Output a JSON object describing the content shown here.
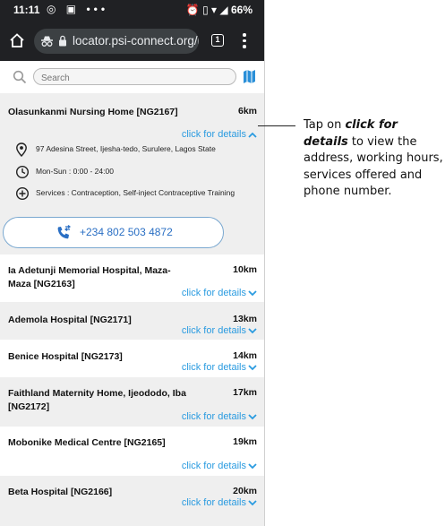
{
  "status_bar": {
    "time": "11:11",
    "battery": "66%",
    "left_icons": "◎ ▣ •••",
    "right_icons": "⏰ ▯ ▾ ◢"
  },
  "browser": {
    "url": "locator.psi-connect.org/l",
    "tab_count": "1"
  },
  "search": {
    "placeholder": "Search"
  },
  "colors": {
    "accent": "#2a9be0",
    "phone_text": "#2a6fc4",
    "toolbar": "#202124",
    "selected_row": "#efefef"
  },
  "expanded": {
    "name": "Olasunkanmi Nursing Home [NG2167]",
    "distance": "6km",
    "details_label": "click for details",
    "address": "97 Adesina Street, Ijesha-tedo, Surulere, Lagos State",
    "hours": "Mon-Sun : 0:00 - 24:00",
    "services": "Services : Contraception, Self-inject Contraceptive Training",
    "phone": "+234 802 503 4872"
  },
  "facilities": [
    {
      "name": "Ia Adetunji Memorial Hospital, Maza-Maza [NG2163]",
      "distance": "10km",
      "details_label": "click for details"
    },
    {
      "name": "Ademola Hospital [NG2171]",
      "distance": "13km",
      "details_label": "click for details"
    },
    {
      "name": "Benice Hospital [NG2173]",
      "distance": "14km",
      "details_label": "click for details"
    },
    {
      "name": "Faithland Maternity Home, Ijeododo, Iba [NG2172]",
      "distance": "17km",
      "details_label": "click for details"
    },
    {
      "name": "Mobonike Medical Centre [NG2165]",
      "distance": "19km",
      "details_label": "click for details"
    },
    {
      "name": "Beta Hospital [NG2166]",
      "distance": "20km",
      "details_label": "click for details"
    }
  ],
  "annotation": {
    "prefix": "Tap on ",
    "emphasis": "click for details",
    "suffix": " to view the address, working hours, services offered and phone number."
  }
}
